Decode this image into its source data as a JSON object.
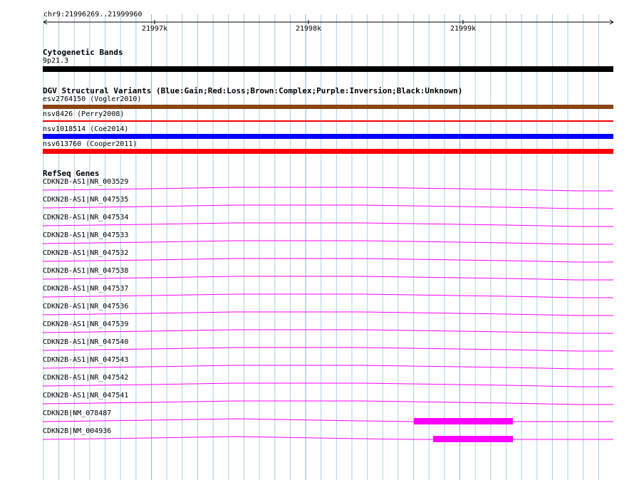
{
  "ruler": {
    "region": "chr9:21996269..21999960",
    "ticks": [
      "21997k",
      "21998k",
      "21999k"
    ]
  },
  "cytobands": {
    "title": "Cytogenetic Bands",
    "band": "9p21.3",
    "band_color": "#000000"
  },
  "dgv": {
    "title": "DGV Structural Variants (Blue:Gain;Red:Loss;Brown:Complex;Purple:Inversion;Black:Unknown)",
    "variants": [
      {
        "label": "esv2764150 (Vogler2010)",
        "color": "#8b4513",
        "type": "Complex"
      },
      {
        "label": "nsv8426 (Perry2008)",
        "color": "#ff0000",
        "type": "Loss"
      },
      {
        "label": "nsv1018514 (Coe2014)",
        "color": "#0000ff",
        "type": "Gain"
      },
      {
        "label": "nsv613760 (Cooper2011)",
        "color": "#ff0000",
        "type": "Loss"
      }
    ]
  },
  "refseq": {
    "title": "RefSeq Genes",
    "gene_color": "#ff00ff",
    "transcripts": [
      {
        "label": "CDKN2B-AS1|NR_003529",
        "has_exon": false
      },
      {
        "label": "CDKN2B-AS1|NR_047535",
        "has_exon": false
      },
      {
        "label": "CDKN2B-AS1|NR_047534",
        "has_exon": false
      },
      {
        "label": "CDKN2B-AS1|NR_047533",
        "has_exon": false
      },
      {
        "label": "CDKN2B-AS1|NR_047532",
        "has_exon": false
      },
      {
        "label": "CDKN2B-AS1|NR_047538",
        "has_exon": false
      },
      {
        "label": "CDKN2B-AS1|NR_047537",
        "has_exon": false
      },
      {
        "label": "CDKN2B-AS1|NR_047536",
        "has_exon": false
      },
      {
        "label": "CDKN2B-AS1|NR_047539",
        "has_exon": false
      },
      {
        "label": "CDKN2B-AS1|NR_047540",
        "has_exon": false
      },
      {
        "label": "CDKN2B-AS1|NR_047543",
        "has_exon": false
      },
      {
        "label": "CDKN2B-AS1|NR_047542",
        "has_exon": false
      },
      {
        "label": "CDKN2B-AS1|NR_047541",
        "has_exon": false
      },
      {
        "label": "CDKN2B|NM_078487",
        "has_exon": true
      },
      {
        "label": "CDKN2B|NM_004936",
        "has_exon": true
      }
    ]
  }
}
